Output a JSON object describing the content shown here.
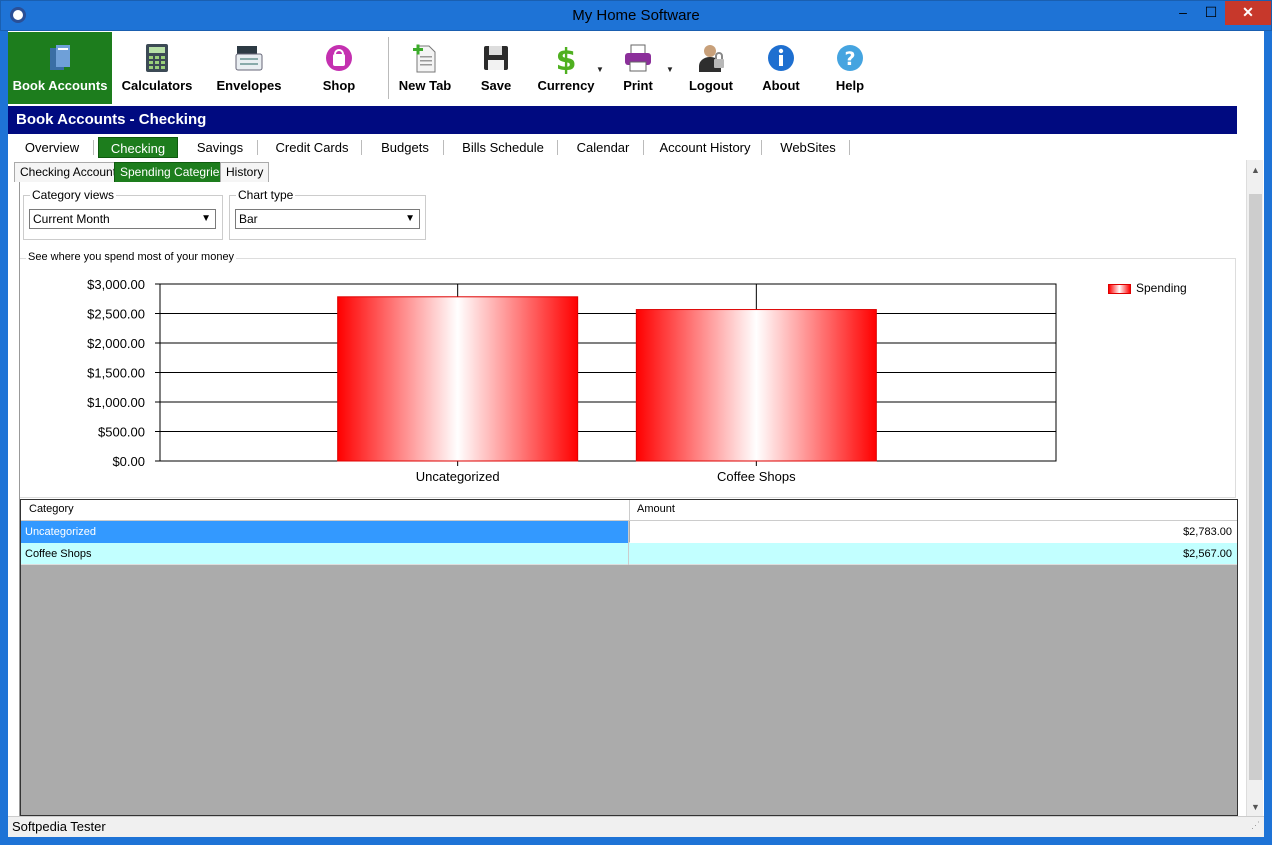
{
  "window": {
    "title": "My Home Software",
    "min": "–",
    "max": "☐",
    "close": "✕"
  },
  "toolbar": {
    "book_accounts": "Book Accounts",
    "calculators": "Calculators",
    "envelopes": "Envelopes",
    "shop": "Shop",
    "new_tab": "New Tab",
    "save": "Save",
    "currency": "Currency",
    "print": "Print",
    "logout": "Logout",
    "about": "About",
    "help": "Help"
  },
  "header": {
    "title": "Book Accounts - Checking"
  },
  "tabs": [
    "Overview",
    "Checking",
    "Savings",
    "Credit Cards",
    "Budgets",
    "Bills Schedule",
    "Calendar",
    "Account History",
    "WebSites"
  ],
  "subtabs": [
    "Checking Account",
    "Spending Categries",
    "History"
  ],
  "filters": {
    "category_views_label": "Category views",
    "category_views_value": "Current Month",
    "chart_type_label": "Chart type",
    "chart_type_value": "Bar"
  },
  "chart_group_label": "See where you spend most of your money",
  "chart_data": {
    "type": "bar",
    "categories": [
      "Uncategorized",
      "Coffee Shops"
    ],
    "series": [
      {
        "name": "Spending",
        "values": [
          2783,
          2567
        ]
      }
    ],
    "ylim": [
      0,
      3000
    ],
    "yticks": [
      0,
      500,
      1000,
      1500,
      2000,
      2500,
      3000
    ],
    "ytick_labels": [
      "$0.00",
      "$500.00",
      "$1,000.00",
      "$1,500.00",
      "$2,000.00",
      "$2,500.00",
      "$3,000.00"
    ],
    "grid": true,
    "legend": "top-right",
    "bar_color": "#ff0000"
  },
  "grid": {
    "headers": [
      "Category",
      "Amount"
    ],
    "rows": [
      {
        "category": "Uncategorized",
        "amount": "$2,783.00"
      },
      {
        "category": "Coffee Shops",
        "amount": "$2,567.00"
      }
    ]
  },
  "status": {
    "user": "Softpedia Tester"
  },
  "colors": {
    "accent_green": "#1d7d1d",
    "header_navy": "#000a80",
    "frame_blue": "#1e73d6"
  }
}
